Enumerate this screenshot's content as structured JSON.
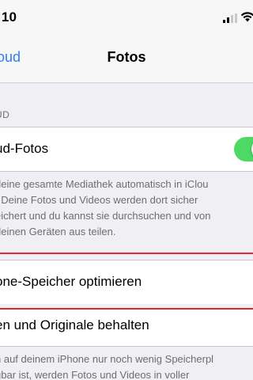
{
  "status_bar": {
    "time": ":10",
    "signal_icon": "cellular-signal-icon",
    "wifi_icon": "wifi-icon"
  },
  "nav": {
    "back_label": "oud",
    "title": "Fotos"
  },
  "section": {
    "header": "UD"
  },
  "icloud_photos": {
    "label": "ud-Fotos",
    "toggle_on": true,
    "toggle_color": "#4cd964"
  },
  "icloud_footer": {
    "lines": [
      "deine gesamte Mediathek automatisch in iClou",
      ". Deine Fotos und Videos werden dort sicher",
      "eichert und du kannst sie durchsuchen und von",
      "deinen Geräten aus teilen."
    ]
  },
  "options": {
    "optimize_label": "one-Speicher optimieren",
    "keep_originals_label": "en und Originale behalten"
  },
  "options_footer": {
    "lines": [
      "n auf deinem iPhone nur noch wenig Speicherpl",
      "gbar ist, werden Fotos und Videos in voller"
    ]
  },
  "colors": {
    "accent": "#2f7cf6",
    "highlight": "#e0262e",
    "background": "#efeff4"
  }
}
